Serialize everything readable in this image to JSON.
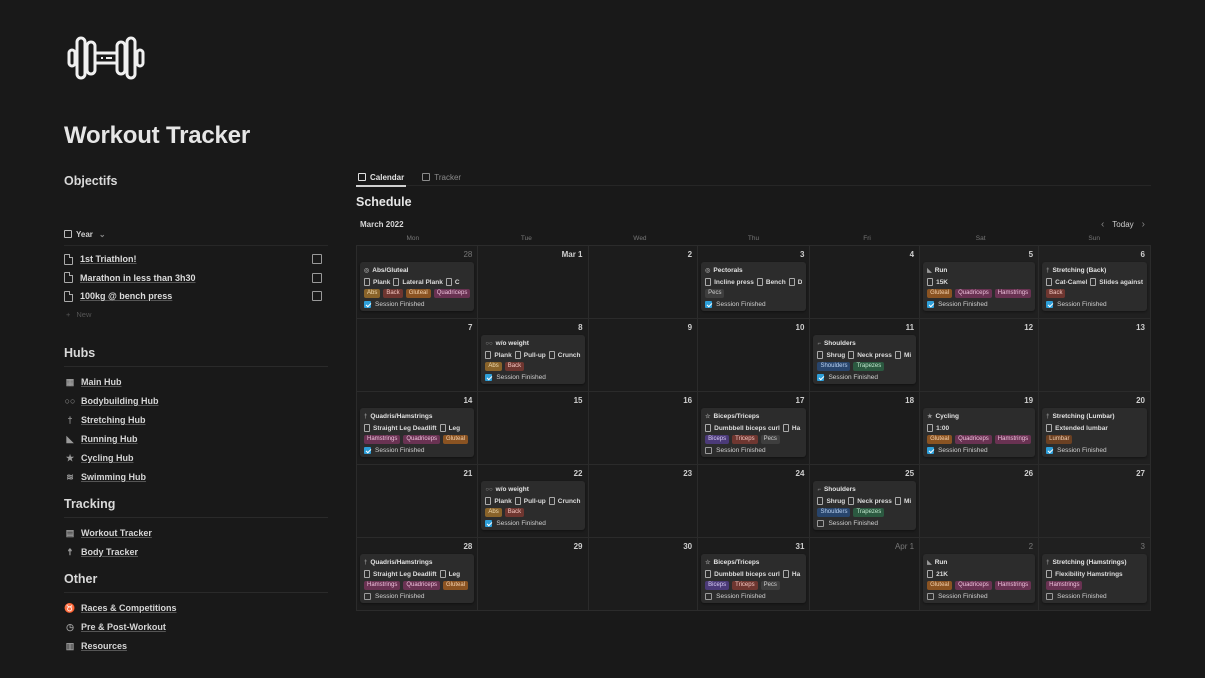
{
  "page": {
    "title": "Workout Tracker",
    "logo_icon": "dumbbell-icon"
  },
  "objectives": {
    "heading": "Objectifs",
    "view_label": "Year",
    "items": [
      {
        "label": "1st Triathlon!",
        "checked": false
      },
      {
        "label": "Marathon in less than 3h30",
        "checked": false
      },
      {
        "label": "100kg @ bench press",
        "checked": false
      }
    ],
    "new_label": "New"
  },
  "hubs": {
    "heading": "Hubs",
    "items": [
      {
        "label": "Main Hub",
        "icon": "calendar-icon"
      },
      {
        "label": "Bodybuilding Hub",
        "icon": "dumbbell-icon"
      },
      {
        "label": "Stretching Hub",
        "icon": "stretch-icon"
      },
      {
        "label": "Running Hub",
        "icon": "shoe-icon"
      },
      {
        "label": "Cycling Hub",
        "icon": "cyclist-icon"
      },
      {
        "label": "Swimming Hub",
        "icon": "swimmer-icon"
      }
    ]
  },
  "tracking": {
    "heading": "Tracking",
    "items": [
      {
        "label": "Workout Tracker",
        "icon": "treadmill-icon"
      },
      {
        "label": "Body Tracker",
        "icon": "body-icon"
      }
    ]
  },
  "other": {
    "heading": "Other",
    "items": [
      {
        "label": "Races & Competitions",
        "icon": "trophy-icon"
      },
      {
        "label": "Pre & Post-Workout",
        "icon": "timer-icon"
      },
      {
        "label": "Resources",
        "icon": "books-icon"
      }
    ]
  },
  "main": {
    "tabs": [
      {
        "label": "Calendar",
        "active": true
      },
      {
        "label": "Tracker",
        "active": false
      }
    ],
    "section_title": "Schedule",
    "month_label": "March 2022",
    "today_label": "Today",
    "weekdays": [
      "Mon",
      "Tue",
      "Wed",
      "Thu",
      "Fri",
      "Sat",
      "Sun"
    ]
  },
  "tag_colors": {
    "Abs": {
      "bg": "#89632a",
      "fg": "#f3dcb1"
    },
    "Back": {
      "bg": "#6e3630",
      "fg": "#f4c6c0"
    },
    "Gluteal": {
      "bg": "#8a5322",
      "fg": "#f5d2ad"
    },
    "Quadriceps": {
      "bg": "#693252",
      "fg": "#eec0dc"
    },
    "Hamstrings": {
      "bg": "#693252",
      "fg": "#eec0dc"
    },
    "Pecs": {
      "bg": "#3e3e3e",
      "fg": "#cfcfcf"
    },
    "Shoulders": {
      "bg": "#28456c",
      "fg": "#bcd4f4"
    },
    "Trapezes": {
      "bg": "#2b5940",
      "fg": "#bfe6cc"
    },
    "Biceps": {
      "bg": "#4b3a78",
      "fg": "#d7cbf5"
    },
    "Triceps": {
      "bg": "#6e3630",
      "fg": "#f4c6c0"
    },
    "Lumbar": {
      "bg": "#6b4022",
      "fg": "#f2cfb3"
    }
  },
  "calendar": {
    "days": [
      {
        "label": "28",
        "other": true,
        "session": {
          "title": "Abs/Gluteal",
          "exercises": [
            "Plank",
            "Lateral Plank",
            "C"
          ],
          "tags": [
            "Abs",
            "Back",
            "Gluteal",
            "Quadriceps"
          ],
          "finished": true
        }
      },
      {
        "label": "Mar 1"
      },
      {
        "label": "2"
      },
      {
        "label": "3",
        "session": {
          "title": "Pectorals",
          "exercises": [
            "Incline press",
            "Bench",
            "D"
          ],
          "tags": [
            "Pecs"
          ],
          "finished": true
        }
      },
      {
        "label": "4"
      },
      {
        "label": "5",
        "session": {
          "title": "Run",
          "exercises": [
            "15K"
          ],
          "tags": [
            "Gluteal",
            "Quadriceps",
            "Hamstrings"
          ],
          "finished": true
        }
      },
      {
        "label": "6",
        "session": {
          "title": "Stretching (Back)",
          "exercises": [
            "Cat-Camel",
            "Slides against"
          ],
          "tags": [
            "Back"
          ],
          "finished": true
        }
      },
      {
        "label": "7"
      },
      {
        "label": "8",
        "session": {
          "title": "w/o weight",
          "exercises": [
            "Plank",
            "Pull-up",
            "Crunch"
          ],
          "tags": [
            "Abs",
            "Back"
          ],
          "finished": true
        }
      },
      {
        "label": "9"
      },
      {
        "label": "10"
      },
      {
        "label": "11",
        "session": {
          "title": "Shoulders",
          "exercises": [
            "Shrug",
            "Neck press",
            "Mi"
          ],
          "tags": [
            "Shoulders",
            "Trapezes"
          ],
          "finished": true
        }
      },
      {
        "label": "12"
      },
      {
        "label": "13"
      },
      {
        "label": "14",
        "session": {
          "title": "Quadris/Hamstrings",
          "exercises": [
            "Straight Leg Deadlift",
            "Leg"
          ],
          "tags": [
            "Hamstrings",
            "Quadriceps",
            "Gluteal"
          ],
          "finished": true
        }
      },
      {
        "label": "15"
      },
      {
        "label": "16"
      },
      {
        "label": "17",
        "session": {
          "title": "Biceps/Triceps",
          "exercises": [
            "Dumbbell biceps curl",
            "Ha"
          ],
          "tags": [
            "Biceps",
            "Triceps",
            "Pecs"
          ],
          "finished": false
        }
      },
      {
        "label": "18"
      },
      {
        "label": "19",
        "session": {
          "title": "Cycling",
          "exercises": [
            "1:00"
          ],
          "tags": [
            "Gluteal",
            "Quadriceps",
            "Hamstrings"
          ],
          "finished": true
        }
      },
      {
        "label": "20",
        "session": {
          "title": "Stretching (Lumbar)",
          "exercises": [
            "Extended lumbar"
          ],
          "tags": [
            "Lumbar"
          ],
          "finished": true
        }
      },
      {
        "label": "21"
      },
      {
        "label": "22",
        "session": {
          "title": "w/o weight",
          "exercises": [
            "Plank",
            "Pull-up",
            "Crunch"
          ],
          "tags": [
            "Abs",
            "Back"
          ],
          "finished": true
        }
      },
      {
        "label": "23"
      },
      {
        "label": "24"
      },
      {
        "label": "25",
        "session": {
          "title": "Shoulders",
          "exercises": [
            "Shrug",
            "Neck press",
            "Mi"
          ],
          "tags": [
            "Shoulders",
            "Trapezes"
          ],
          "finished": false
        }
      },
      {
        "label": "26"
      },
      {
        "label": "27"
      },
      {
        "label": "28",
        "session": {
          "title": "Quadris/Hamstrings",
          "exercises": [
            "Straight Leg Deadlift",
            "Leg"
          ],
          "tags": [
            "Hamstrings",
            "Quadriceps",
            "Gluteal"
          ],
          "finished": false
        }
      },
      {
        "label": "29"
      },
      {
        "label": "30"
      },
      {
        "label": "31",
        "session": {
          "title": "Biceps/Triceps",
          "exercises": [
            "Dumbbell biceps curl",
            "Ha"
          ],
          "tags": [
            "Biceps",
            "Triceps",
            "Pecs"
          ],
          "finished": false
        }
      },
      {
        "label": "Apr 1",
        "other": true
      },
      {
        "label": "2",
        "other": true,
        "session": {
          "title": "Run",
          "exercises": [
            "21K"
          ],
          "tags": [
            "Gluteal",
            "Quadriceps",
            "Hamstrings"
          ],
          "finished": false
        }
      },
      {
        "label": "3",
        "other": true,
        "session": {
          "title": "Stretching (Hamstrings)",
          "exercises": [
            "Flexibility Hamstrings"
          ],
          "tags": [
            "Hamstrings"
          ],
          "finished": false
        }
      }
    ],
    "status_label": "Session Finished"
  }
}
